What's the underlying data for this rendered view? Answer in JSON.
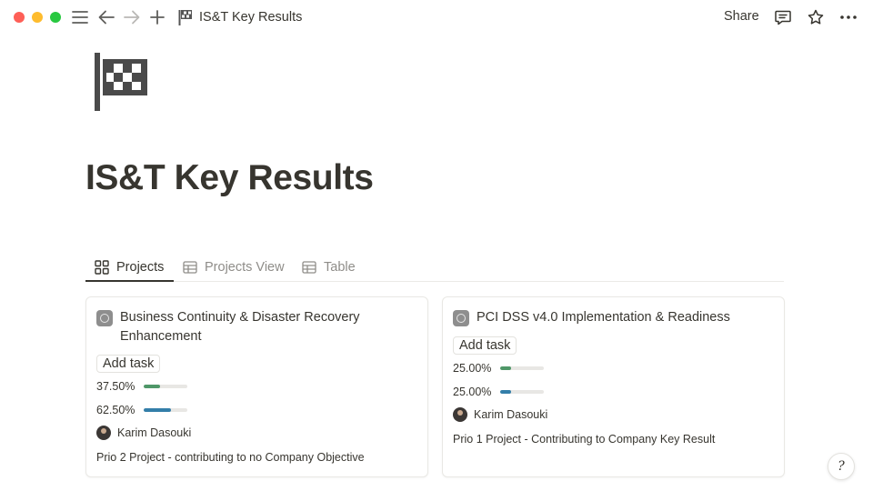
{
  "window": {
    "title": "IS&T Key Results"
  },
  "toolbar": {
    "share_label": "Share"
  },
  "page": {
    "title": "IS&T Key Results"
  },
  "tabs": [
    {
      "label": "Projects",
      "icon": "gallery-icon",
      "active": true
    },
    {
      "label": "Projects View",
      "icon": "table-icon",
      "active": false
    },
    {
      "label": "Table",
      "icon": "table-icon",
      "active": false
    }
  ],
  "cards": [
    {
      "title": "Business Continuity & Disaster Recovery Enhancement",
      "add_task_label": "Add task",
      "progress": [
        {
          "label": "37.50%",
          "value": 0.375,
          "color": "#4f9768"
        },
        {
          "label": "62.50%",
          "value": 0.625,
          "color": "#337ea9"
        }
      ],
      "owner": "Karim Dasouki",
      "note": "Prio 2 Project - contributing to no Company Objective"
    },
    {
      "title": "PCI DSS v4.0 Implementation & Readiness",
      "add_task_label": "Add task",
      "progress": [
        {
          "label": "25.00%",
          "value": 0.25,
          "color": "#4f9768"
        },
        {
          "label": "25.00%",
          "value": 0.25,
          "color": "#337ea9"
        }
      ],
      "owner": "Karim Dasouki",
      "note": "Prio 1 Project - Contributing to Company Key Result"
    }
  ],
  "help": {
    "label": "?"
  }
}
